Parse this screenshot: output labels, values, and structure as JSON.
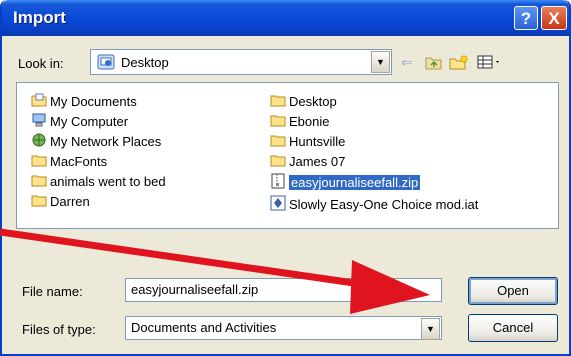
{
  "window": {
    "title": "Import"
  },
  "titlebar": {
    "help_label": "?",
    "close_label": "X"
  },
  "look_in": {
    "label": "Look in:",
    "value": "Desktop"
  },
  "toolbar_icons": [
    "back-arrow-icon",
    "up-folder-icon",
    "new-folder-icon",
    "view-menu-icon"
  ],
  "files": {
    "col1": [
      {
        "label": "My Documents",
        "icon": "my-documents-icon"
      },
      {
        "label": "My Computer",
        "icon": "my-computer-icon"
      },
      {
        "label": "My Network Places",
        "icon": "network-places-icon"
      },
      {
        "label": "MacFonts",
        "icon": "folder-icon"
      },
      {
        "label": "animals went to bed",
        "icon": "folder-icon"
      },
      {
        "label": "Darren",
        "icon": "folder-icon"
      }
    ],
    "col2": [
      {
        "label": "Desktop",
        "icon": "folder-icon"
      },
      {
        "label": "Ebonie",
        "icon": "folder-icon"
      },
      {
        "label": "Huntsville",
        "icon": "folder-icon"
      },
      {
        "label": "James 07",
        "icon": "folder-icon"
      },
      {
        "label": "easyjournaliseefall.zip",
        "icon": "zip-file-icon",
        "selected": true
      },
      {
        "label": "Slowly Easy-One Choice mod.iat",
        "icon": "iat-file-icon"
      }
    ]
  },
  "file_name": {
    "label": "File name:",
    "value": "easyjournaliseefall.zip"
  },
  "files_of_type": {
    "label": "Files of type:",
    "value": "Documents and Activities"
  },
  "buttons": {
    "open": "Open",
    "cancel": "Cancel"
  },
  "colors": {
    "titlebar": "#0a48d8",
    "selection": "#316ac5",
    "arrow": "#e0141e",
    "dialog_bg": "#ece9d8"
  }
}
